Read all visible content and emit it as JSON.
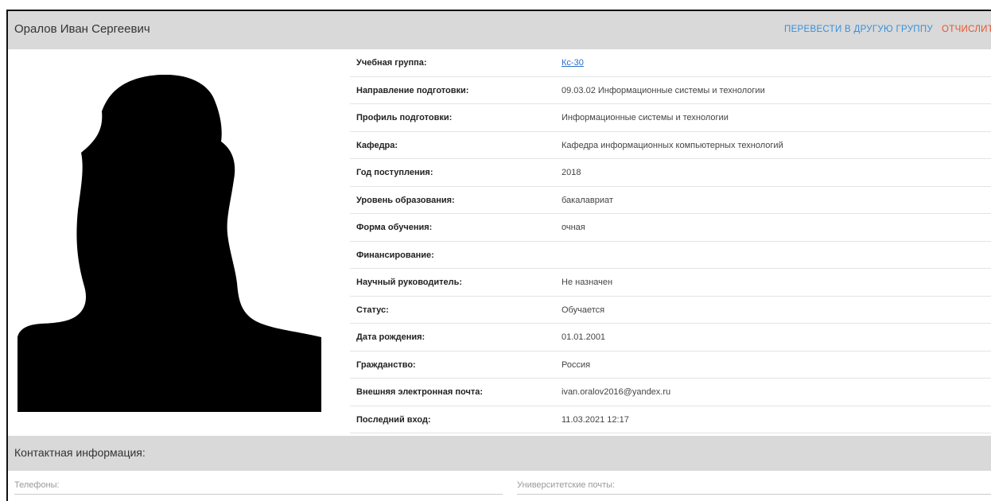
{
  "header": {
    "student_name": "Оралов Иван Сергеевич",
    "transfer_label": "ПЕРЕВЕСТИ В ДРУГУЮ ГРУППУ",
    "expel_label": "ОТЧИСЛИТ"
  },
  "info": [
    {
      "label": "Учебная группа:",
      "value": "Кс-30"
    },
    {
      "label": "Направление подготовки:",
      "value": "09.03.02 Информационные системы и технологии"
    },
    {
      "label": "Профиль подготовки:",
      "value": "Информационные системы и технологии"
    },
    {
      "label": "Кафедра:",
      "value": "Кафедра информационных компьютерных технологий"
    },
    {
      "label": "Год поступления:",
      "value": "2018"
    },
    {
      "label": "Уровень образования:",
      "value": "бакалавриат"
    },
    {
      "label": "Форма обучения:",
      "value": "очная"
    },
    {
      "label": "Финансирование:",
      "value": ""
    },
    {
      "label": "Научный руководитель:",
      "value": "Не назначен"
    },
    {
      "label": "Статус:",
      "value": "Обучается"
    },
    {
      "label": "Дата рождения:",
      "value": "01.01.2001"
    },
    {
      "label": "Гражданство:",
      "value": "Россия"
    },
    {
      "label": "Внешняя электронная почта:",
      "value": "ivan.oralov2016@yandex.ru"
    },
    {
      "label": "Последний вход:",
      "value": "11.03.2021 12:17"
    }
  ],
  "contacts": {
    "title": "Контактная информация:",
    "phones_label": "Телефоны:",
    "university_emails_label": "Университетские почты:"
  },
  "colors": {
    "header_bg": "#d9d9d9",
    "link_blue": "#3a8fd9",
    "danger_orange": "#e8542f"
  },
  "icons": {
    "photo": "avatar-silhouette-icon"
  }
}
